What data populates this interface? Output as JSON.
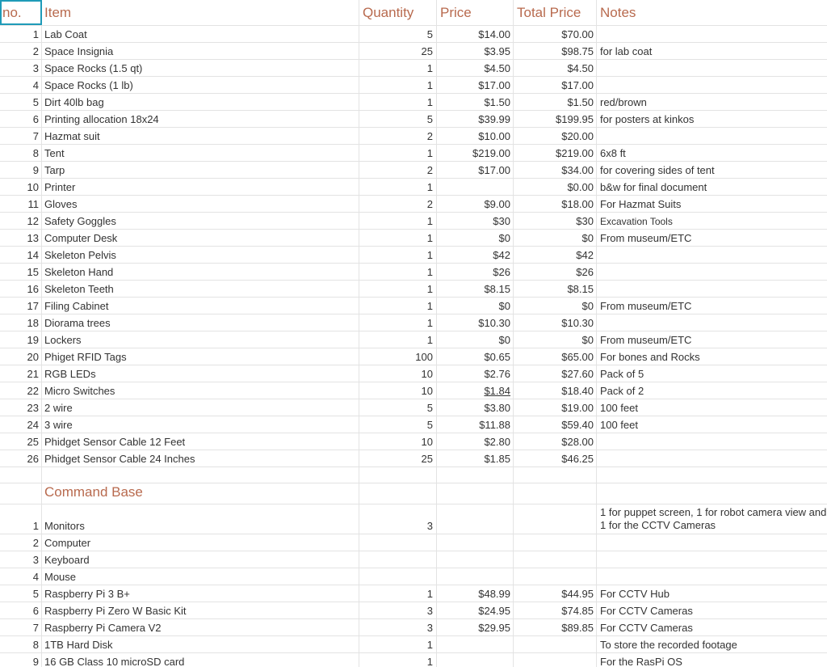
{
  "headers": {
    "no": "no.",
    "item": "Item",
    "quantity": "Quantity",
    "price": "Price",
    "total": "Total Price",
    "notes": "Notes"
  },
  "rows": [
    {
      "no": "1",
      "item": "Lab Coat",
      "qty": "5",
      "price": "$14.00",
      "total": "$70.00",
      "notes": ""
    },
    {
      "no": "2",
      "item": "Space Insignia",
      "qty": "25",
      "price": "$3.95",
      "total": "$98.75",
      "notes": "for lab coat"
    },
    {
      "no": "3",
      "item": "Space Rocks (1.5 qt)",
      "qty": "1",
      "price": "$4.50",
      "total": "$4.50",
      "notes": ""
    },
    {
      "no": "4",
      "item": "Space Rocks (1 lb)",
      "qty": "1",
      "price": "$17.00",
      "total": "$17.00",
      "notes": ""
    },
    {
      "no": "5",
      "item": "Dirt 40lb bag",
      "qty": "1",
      "price": "$1.50",
      "total": "$1.50",
      "notes": "red/brown"
    },
    {
      "no": "6",
      "item": "Printing allocation 18x24",
      "qty": "5",
      "price": "$39.99",
      "total": "$199.95",
      "notes": "for posters at kinkos"
    },
    {
      "no": "7",
      "item": "Hazmat suit",
      "qty": "2",
      "price": "$10.00",
      "total": "$20.00",
      "notes": ""
    },
    {
      "no": "8",
      "item": "Tent",
      "qty": "1",
      "price": "$219.00",
      "total": "$219.00",
      "notes": "6x8 ft"
    },
    {
      "no": "9",
      "item": "Tarp",
      "qty": "2",
      "price": "$17.00",
      "total": "$34.00",
      "notes": "for covering sides of tent"
    },
    {
      "no": "10",
      "item": "Printer",
      "qty": "1",
      "price": "",
      "total": "$0.00",
      "notes": "b&w for final document"
    },
    {
      "no": "11",
      "item": "Gloves",
      "qty": "2",
      "price": "$9.00",
      "total": "$18.00",
      "notes": "For Hazmat Suits"
    },
    {
      "no": "12",
      "item": "Safety Goggles",
      "qty": "1",
      "price": "$30",
      "total": "$30",
      "notes": "Excavation Tools",
      "notes_small": true
    },
    {
      "no": "13",
      "item": "Computer Desk",
      "qty": "1",
      "price": "$0",
      "total": "$0",
      "notes": "From museum/ETC"
    },
    {
      "no": "14",
      "item": "Skeleton Pelvis",
      "qty": "1",
      "price": "$42",
      "total": "$42",
      "notes": ""
    },
    {
      "no": "15",
      "item": "Skeleton Hand",
      "qty": "1",
      "price": "$26",
      "total": "$26",
      "notes": ""
    },
    {
      "no": "16",
      "item": "Skeleton Teeth",
      "qty": "1",
      "price": "$8.15",
      "total": "$8.15",
      "notes": ""
    },
    {
      "no": "17",
      "item": "Filing Cabinet",
      "qty": "1",
      "price": "$0",
      "total": "$0",
      "notes": "From museum/ETC"
    },
    {
      "no": "18",
      "item": "Diorama trees",
      "qty": "1",
      "price": "$10.30",
      "total": "$10.30",
      "notes": ""
    },
    {
      "no": "19",
      "item": "Lockers",
      "qty": "1",
      "price": "$0",
      "total": "$0",
      "notes": "From museum/ETC"
    },
    {
      "no": "20",
      "item": "Phiget RFID Tags",
      "qty": "100",
      "price": "$0.65",
      "total": "$65.00",
      "notes": "For bones and Rocks"
    },
    {
      "no": "21",
      "item": "RGB LEDs",
      "qty": "10",
      "price": "$2.76",
      "total": "$27.60",
      "notes": "Pack of 5"
    },
    {
      "no": "22",
      "item": "Micro Switches",
      "qty": "10",
      "price": "$1.84",
      "total": "$18.40",
      "notes": "Pack of 2",
      "price_underline": true
    },
    {
      "no": "23",
      "item": "2 wire",
      "qty": "5",
      "price": "$3.80",
      "total": "$19.00",
      "notes": "100 feet"
    },
    {
      "no": "24",
      "item": "3 wire",
      "qty": "5",
      "price": "$11.88",
      "total": "$59.40",
      "notes": "100 feet"
    },
    {
      "no": "25",
      "item": "Phidget Sensor Cable 12 Feet",
      "qty": "10",
      "price": "$2.80",
      "total": "$28.00",
      "notes": ""
    },
    {
      "no": "26",
      "item": "Phidget Sensor Cable 24 Inches",
      "qty": "25",
      "price": "$1.85",
      "total": "$46.25",
      "notes": ""
    }
  ],
  "section_title": "Command Base",
  "command_rows": [
    {
      "no": "1",
      "item": "Monitors",
      "qty": "3",
      "price": "",
      "total": "",
      "notes": "1 for puppet screen, 1 for robot camera view and 1 for the CCTV Cameras"
    },
    {
      "no": "2",
      "item": "Computer",
      "qty": "",
      "price": "",
      "total": "",
      "notes": ""
    },
    {
      "no": "3",
      "item": "Keyboard",
      "qty": "",
      "price": "",
      "total": "",
      "notes": ""
    },
    {
      "no": "4",
      "item": "Mouse",
      "qty": "",
      "price": "",
      "total": "",
      "notes": ""
    },
    {
      "no": "5",
      "item": "Raspberry Pi 3 B+",
      "qty": "1",
      "price": "$48.99",
      "total": "$44.95",
      "notes": "For CCTV Hub"
    },
    {
      "no": "6",
      "item": "Raspberry Pi Zero W Basic Kit",
      "qty": "3",
      "price": "$24.95",
      "total": "$74.85",
      "notes": "For CCTV Cameras"
    },
    {
      "no": "7",
      "item": "Raspberry Pi Camera V2",
      "qty": "3",
      "price": "$29.95",
      "total": "$89.85",
      "notes": "For CCTV Cameras"
    },
    {
      "no": "8",
      "item": "1TB Hard Disk",
      "qty": "1",
      "price": "",
      "total": "",
      "notes": "To store the recorded footage"
    },
    {
      "no": "9",
      "item": "16 GB Class 10 microSD card",
      "qty": "1",
      "price": "",
      "total": "",
      "notes": "For the RasPi OS"
    }
  ]
}
